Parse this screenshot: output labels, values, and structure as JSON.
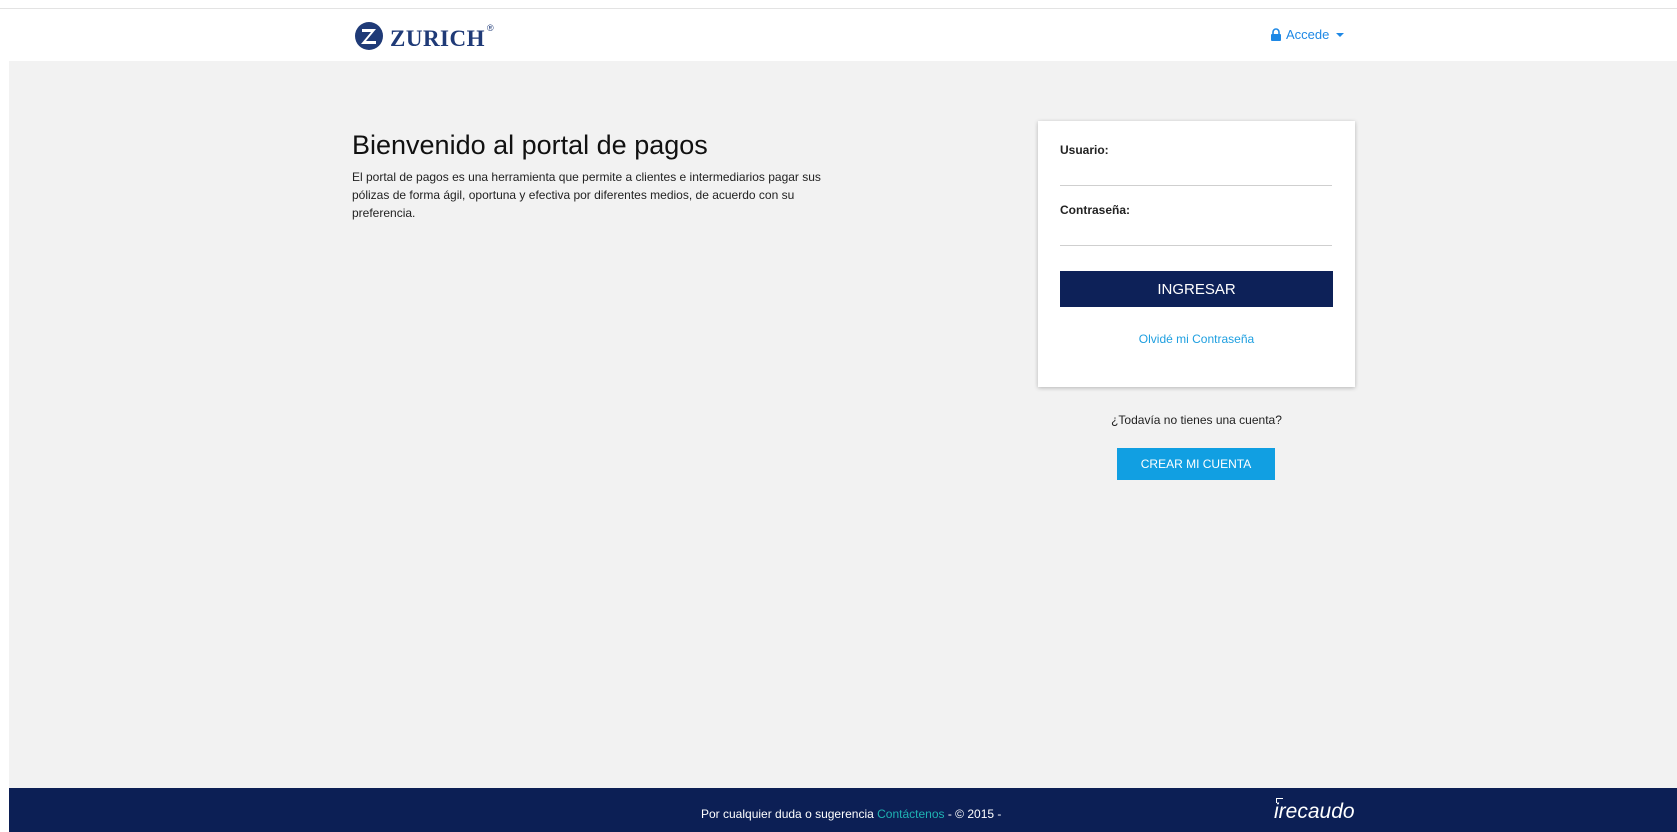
{
  "header": {
    "brand": "ZURICH",
    "brand_reg": "®",
    "accede_label": "Accede"
  },
  "welcome": {
    "title": "Bienvenido al portal de pagos",
    "description": "El portal de pagos es una herramienta que permite a clientes e intermediarios pagar sus pólizas de forma ágil, oportuna y efectiva por diferentes medios, de acuerdo con su preferencia."
  },
  "login": {
    "username_label": "Usuario:",
    "username_value": "",
    "password_label": "Contraseña:",
    "password_value": "",
    "submit_label": "INGRESAR",
    "forgot_label": "Olvidé mi Contraseña"
  },
  "signup": {
    "prompt": "¿Todavía no tienes una cuenta?",
    "button_label": "CREAR MI CUENTA"
  },
  "footer": {
    "text_before": "Por cualquier duda o sugerencia ",
    "contact_label": "Contáctenos",
    "text_after": " - © 2015 -",
    "partner_logo_i": "i",
    "partner_logo_rest": "recaudo"
  },
  "colors": {
    "brand_navy": "#0d2158",
    "link_blue": "#1e9fe0",
    "create_button": "#119fe2",
    "footer_bg": "#0c1f55",
    "contact_teal": "#1fb3b3",
    "page_bg": "#f2f2f2"
  },
  "icons": {
    "brand_mark": "zurich-logo-icon",
    "accede": "lock-icon",
    "accede_dropdown": "caret-down-icon"
  }
}
